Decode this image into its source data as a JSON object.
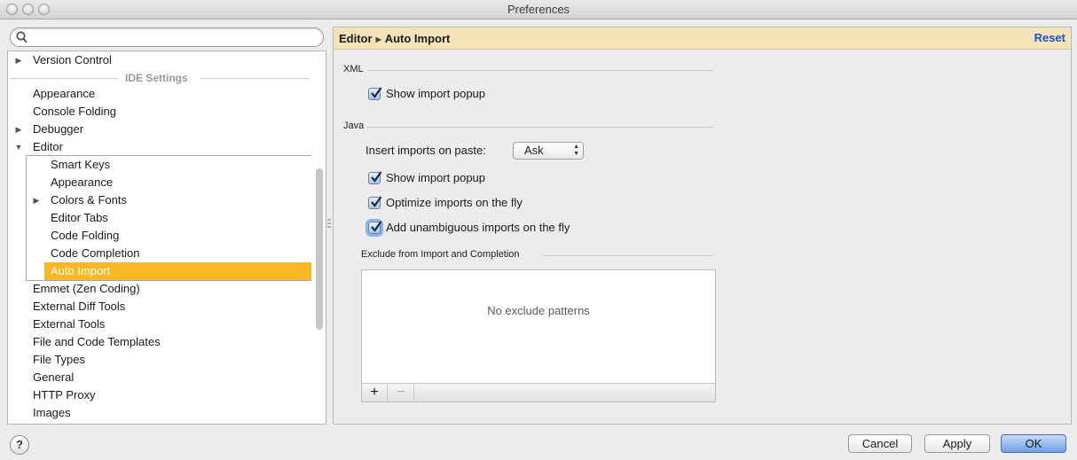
{
  "window": {
    "title": "Preferences"
  },
  "search": {
    "value": "",
    "placeholder": ""
  },
  "tree": {
    "version_control": "Version Control",
    "section_label": "IDE Settings",
    "items_top": [
      "Appearance",
      "Console Folding",
      "Debugger",
      "Editor"
    ],
    "editor_children": [
      "Smart Keys",
      "Appearance",
      "Colors & Fonts",
      "Editor Tabs",
      "Code Folding",
      "Code Completion",
      "Auto Import"
    ],
    "selected": "Auto Import",
    "items_bottom": [
      "Emmet (Zen Coding)",
      "External Diff Tools",
      "External Tools",
      "File and Code Templates",
      "File Types",
      "General",
      "HTTP Proxy",
      "Images"
    ]
  },
  "breadcrumb": {
    "parent": "Editor",
    "current": "Auto Import",
    "reset_label": "Reset"
  },
  "xml": {
    "label": "XML",
    "show_import_popup": "Show import popup"
  },
  "java": {
    "label": "Java",
    "insert_imports_label": "Insert imports on paste:",
    "insert_imports_value": "Ask",
    "show_import_popup": "Show import popup",
    "optimize_imports": "Optimize imports on the fly",
    "add_unambiguous": "Add unambiguous imports on the fly"
  },
  "exclude": {
    "label": "Exclude from Import and Completion",
    "empty_text": "No exclude patterns",
    "add_label": "+",
    "remove_label": "−"
  },
  "buttons": {
    "help": "?",
    "cancel": "Cancel",
    "apply": "Apply",
    "ok": "OK"
  },
  "colors": {
    "selection": "#f7b824",
    "crumb_bg": "#f5e2b6",
    "link": "#1a55c9"
  }
}
